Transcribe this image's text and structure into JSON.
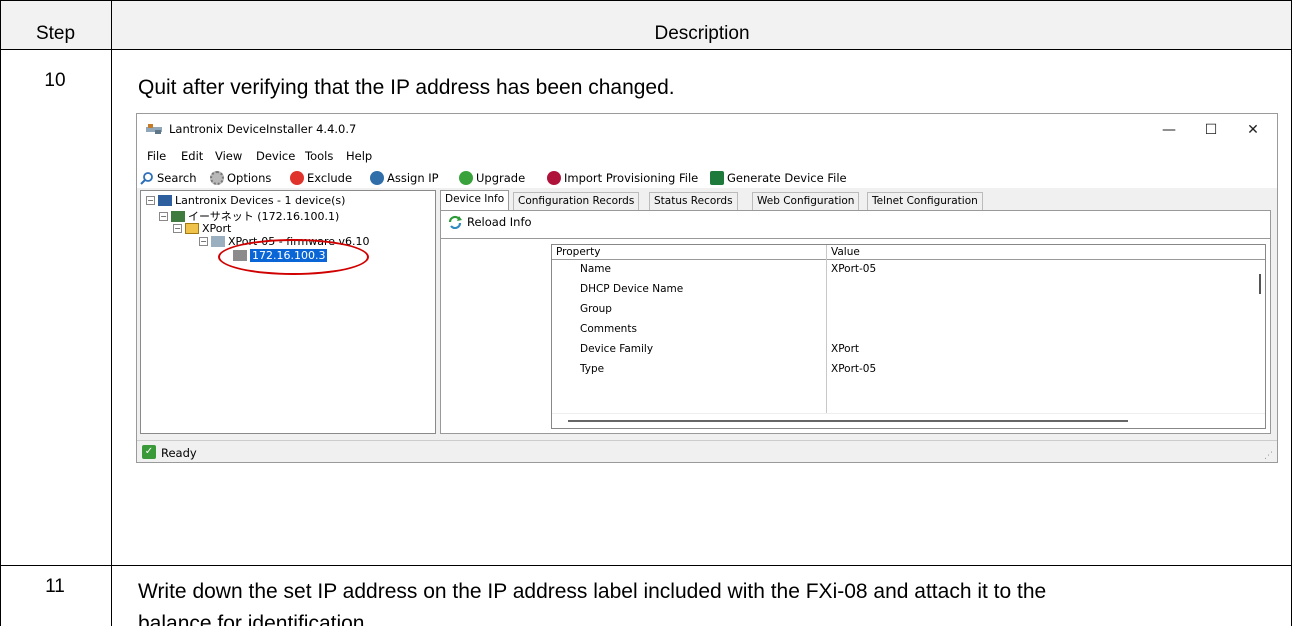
{
  "table": {
    "header_step": "Step",
    "header_description": "Description",
    "rows": [
      {
        "step": "10",
        "text": "Quit after verifying that the IP address has been changed."
      },
      {
        "step": "11",
        "text_line1": "Write down the set IP address on the IP address label included with the FXi-08 and attach it to the",
        "text_line2": "balance for identification."
      }
    ]
  },
  "window": {
    "title": "Lantronix DeviceInstaller 4.4.0.7",
    "controls": {
      "minimize": "—",
      "maximize": "☐",
      "close": "✕"
    },
    "menu": [
      "File",
      "Edit",
      "View",
      "Device",
      "Tools",
      "Help"
    ],
    "toolbar": [
      "Search",
      "Options",
      "Exclude",
      "Assign IP",
      "Upgrade",
      "Import Provisioning File",
      "Generate Device File"
    ],
    "tree": {
      "root": "Lantronix Devices - 1 device(s)",
      "network": "イーサネット (172.16.100.1)",
      "group": "XPort",
      "device": "XPort-05 - firmware v6.10",
      "ip": "172.16.100.3"
    },
    "tabs": [
      "Device Info",
      "Configuration Records",
      "Status Records",
      "Web Configuration",
      "Telnet Configuration"
    ],
    "reload_label": "Reload Info",
    "grid": {
      "columns": [
        "Property",
        "Value"
      ],
      "rows": [
        {
          "property": "Name",
          "value": "XPort-05"
        },
        {
          "property": "DHCP Device Name",
          "value": ""
        },
        {
          "property": "Group",
          "value": ""
        },
        {
          "property": "Comments",
          "value": ""
        },
        {
          "property": "Device Family",
          "value": "XPort"
        },
        {
          "property": "Type",
          "value": "XPort-05"
        }
      ]
    },
    "status": "Ready"
  },
  "colors": {
    "selection": "#0a66d6",
    "highlight_ellipse": "#d00000",
    "header_bg": "#f2f2f2"
  }
}
